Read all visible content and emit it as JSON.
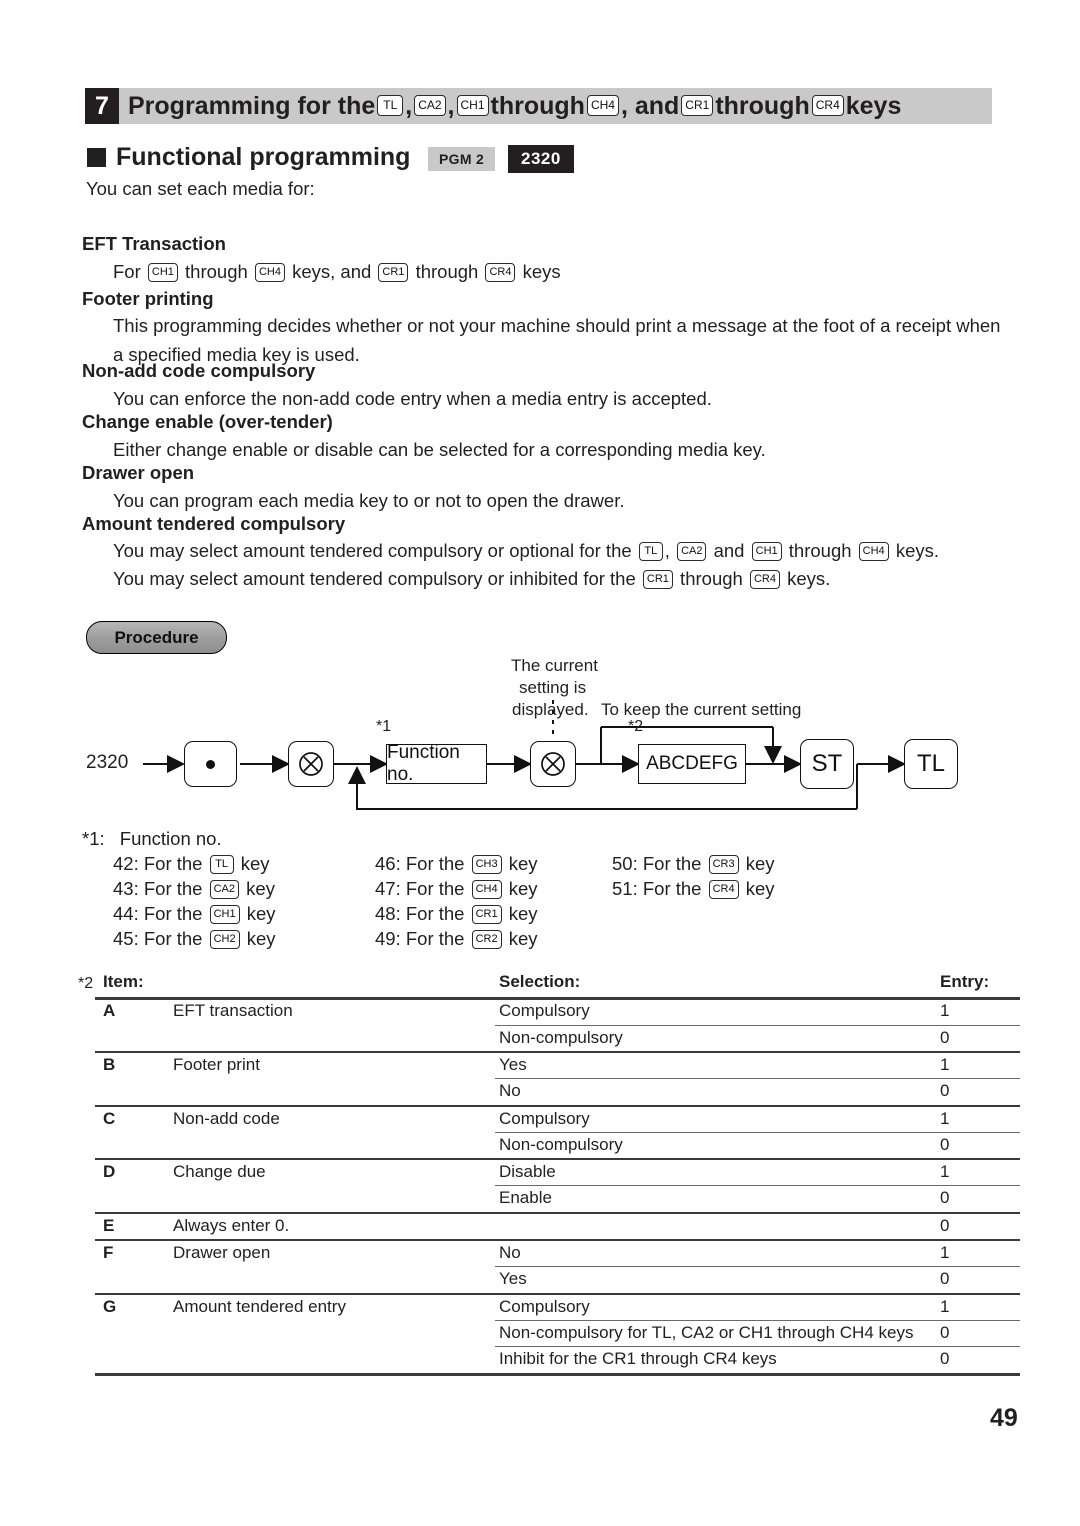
{
  "section": {
    "number": "7",
    "title_parts": [
      {
        "type": "text",
        "value": "Programming for the "
      },
      {
        "type": "key",
        "value": "TL"
      },
      {
        "type": "text",
        "value": ", "
      },
      {
        "type": "key",
        "value": "CA2"
      },
      {
        "type": "text",
        "value": ", "
      },
      {
        "type": "key",
        "value": "CH1"
      },
      {
        "type": "text",
        "value": " through "
      },
      {
        "type": "key",
        "value": "CH4"
      },
      {
        "type": "text",
        "value": ", and "
      },
      {
        "type": "key",
        "value": "CR1"
      },
      {
        "type": "text",
        "value": " through "
      },
      {
        "type": "key",
        "value": "CR4"
      },
      {
        "type": "text",
        "value": " keys"
      }
    ],
    "title_plain": "Programming for the TL, CA2, CH1 through CH4, and CR1 through CR4 keys"
  },
  "subsection": {
    "title": "Functional programming",
    "badge_mode": "PGM 2",
    "badge_code": "2320"
  },
  "intro": "You can set each media for:",
  "topics": [
    {
      "heading": "EFT Transaction",
      "lines": [
        {
          "parts": [
            {
              "type": "text",
              "value": "For "
            },
            {
              "type": "key",
              "value": "CH1"
            },
            {
              "type": "text",
              "value": " through "
            },
            {
              "type": "key",
              "value": "CH4"
            },
            {
              "type": "text",
              "value": " keys, and "
            },
            {
              "type": "key",
              "value": "CR1"
            },
            {
              "type": "text",
              "value": " through "
            },
            {
              "type": "key",
              "value": "CR4"
            },
            {
              "type": "text",
              "value": " keys"
            }
          ]
        }
      ]
    },
    {
      "heading": "Footer printing",
      "lines": [
        {
          "parts": [
            {
              "type": "text",
              "value": "This programming decides whether or not your machine should print a message at the foot of a receipt when"
            }
          ]
        },
        {
          "parts": [
            {
              "type": "text",
              "value": "a specified media key is used."
            }
          ]
        }
      ]
    },
    {
      "heading": "Non-add code compulsory",
      "lines": [
        {
          "parts": [
            {
              "type": "text",
              "value": "You can enforce the non-add code entry when a media entry is accepted."
            }
          ]
        }
      ]
    },
    {
      "heading": "Change enable (over-tender)",
      "lines": [
        {
          "parts": [
            {
              "type": "text",
              "value": "Either change enable or disable can be selected for a corresponding media key."
            }
          ]
        }
      ]
    },
    {
      "heading": "Drawer open",
      "lines": [
        {
          "parts": [
            {
              "type": "text",
              "value": "You can program each media key to or not to open the drawer."
            }
          ]
        }
      ]
    },
    {
      "heading": "Amount tendered compulsory",
      "lines": [
        {
          "parts": [
            {
              "type": "text",
              "value": "You may select amount tendered compulsory or optional for the "
            },
            {
              "type": "key",
              "value": "TL"
            },
            {
              "type": "text",
              "value": ", "
            },
            {
              "type": "key",
              "value": "CA2"
            },
            {
              "type": "text",
              "value": " and "
            },
            {
              "type": "key",
              "value": "CH1"
            },
            {
              "type": "text",
              "value": " through "
            },
            {
              "type": "key",
              "value": "CH4"
            },
            {
              "type": "text",
              "value": " keys."
            }
          ]
        },
        {
          "parts": [
            {
              "type": "text",
              "value": "You may select amount tendered compulsory or inhibited for the "
            },
            {
              "type": "key",
              "value": "CR1"
            },
            {
              "type": "text",
              "value": " through "
            },
            {
              "type": "key",
              "value": "CR4"
            },
            {
              "type": "text",
              "value": " keys."
            }
          ]
        }
      ]
    }
  ],
  "procedure": {
    "label": "Procedure",
    "start_code": "2320",
    "note_current": "The current\nsetting is\ndisplayed.",
    "note_current_l1": "The current",
    "note_current_l2": "setting is",
    "note_current_l3": "displayed.",
    "note_keep": "To keep the current setting",
    "mark1": "*1",
    "mark2": "*2",
    "box_function": "Function no.",
    "box_abcdefg": "ABCDEFG",
    "key_point": "point-key",
    "key_multiply": "multiply-key",
    "key_st": "ST",
    "key_tl": "TL"
  },
  "footnote1": {
    "label": "*1:",
    "title": "Function no.",
    "columns": [
      [
        {
          "no": "42: For the",
          "key": "TL",
          "tail": "key"
        },
        {
          "no": "43: For the",
          "key": "CA2",
          "tail": "key"
        },
        {
          "no": "44: For the",
          "key": "CH1",
          "tail": "key"
        },
        {
          "no": "45: For the",
          "key": "CH2",
          "tail": "key"
        }
      ],
      [
        {
          "no": "46: For the",
          "key": "CH3",
          "tail": "key"
        },
        {
          "no": "47: For the",
          "key": "CH4",
          "tail": "key"
        },
        {
          "no": "48: For the",
          "key": "CR1",
          "tail": "key"
        },
        {
          "no": "49: For the",
          "key": "CR2",
          "tail": "key"
        }
      ],
      [
        {
          "no": "50: For the",
          "key": "CR3",
          "tail": "key"
        },
        {
          "no": "51: For the",
          "key": "CR4",
          "tail": "key"
        }
      ]
    ]
  },
  "footnote2": {
    "label": "*2",
    "headers": {
      "item": "Item:",
      "selection": "Selection:",
      "entry": "Entry:"
    },
    "rows": [
      {
        "item": "A",
        "desc": "EFT transaction",
        "options": [
          {
            "selection": "Compulsory",
            "entry": "1"
          },
          {
            "selection": "Non-compulsory",
            "entry": "0"
          }
        ]
      },
      {
        "item": "B",
        "desc": "Footer print",
        "options": [
          {
            "selection": "Yes",
            "entry": "1"
          },
          {
            "selection": "No",
            "entry": "0"
          }
        ]
      },
      {
        "item": "C",
        "desc": "Non-add code",
        "options": [
          {
            "selection": "Compulsory",
            "entry": "1"
          },
          {
            "selection": "Non-compulsory",
            "entry": "0"
          }
        ]
      },
      {
        "item": "D",
        "desc": "Change due",
        "options": [
          {
            "selection": "Disable",
            "entry": "1"
          },
          {
            "selection": "Enable",
            "entry": "0"
          }
        ]
      },
      {
        "item": "E",
        "desc": "Always enter 0.",
        "options": [
          {
            "selection": "",
            "entry": "0"
          }
        ]
      },
      {
        "item": "F",
        "desc": "Drawer open",
        "options": [
          {
            "selection": "No",
            "entry": "1"
          },
          {
            "selection": "Yes",
            "entry": "0"
          }
        ]
      },
      {
        "item": "G",
        "desc": "Amount tendered entry",
        "options": [
          {
            "selection": "Compulsory",
            "entry": "1"
          },
          {
            "selection": "Non-compulsory for TL, CA2 or CH1 through  CH4 keys",
            "entry": "0"
          },
          {
            "selection": "Inhibit for the CR1 through CR4 keys",
            "entry": "0"
          }
        ]
      }
    ]
  },
  "page_number": "49",
  "colors": {
    "header_bar": "#c9c9c9",
    "badge_dark": "#231f20",
    "text": "#231f20",
    "rule": "#3a3a3a"
  }
}
